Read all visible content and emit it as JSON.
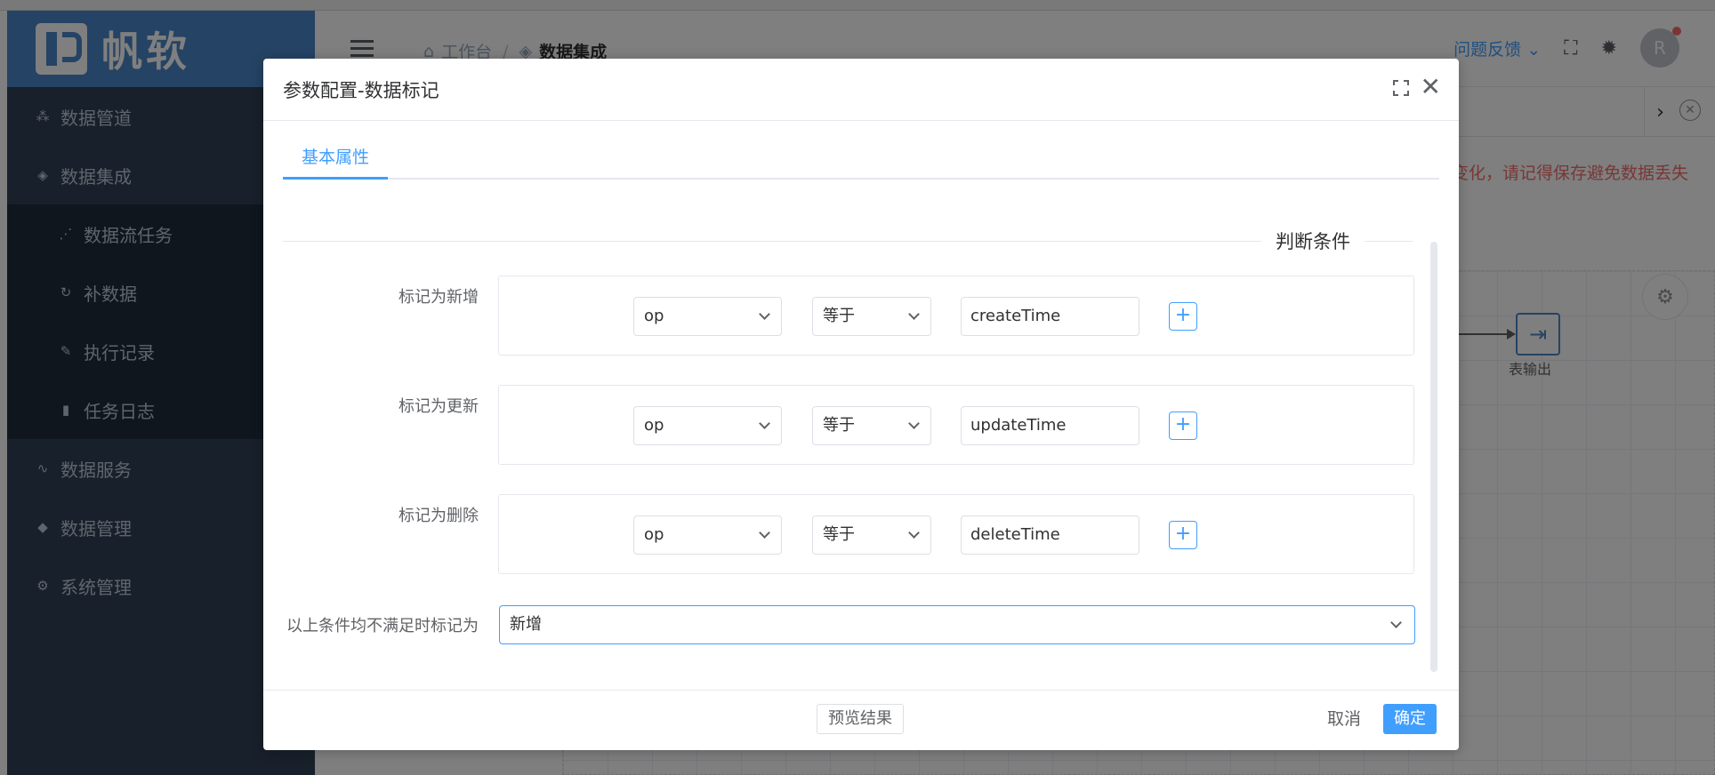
{
  "app": {
    "logo_text": "帆软",
    "sidebar": {
      "items": [
        {
          "label": "数据管道",
          "icon": "pipeline-icon"
        },
        {
          "label": "数据集成",
          "icon": "layers-icon"
        },
        {
          "label": "数据流任务",
          "icon": "share-icon"
        },
        {
          "label": "补数据",
          "icon": "refresh-icon"
        },
        {
          "label": "执行记录",
          "icon": "pen-icon"
        },
        {
          "label": "任务日志",
          "icon": "document-icon"
        },
        {
          "label": "数据服务",
          "icon": "pulse-icon"
        },
        {
          "label": "数据管理",
          "icon": "cube-icon"
        },
        {
          "label": "系统管理",
          "icon": "gear-icon"
        }
      ]
    },
    "breadcrumb": {
      "home": "工作台",
      "separator": "/",
      "current": "数据集成"
    },
    "header": {
      "feedback_label": "问题反馈",
      "avatar_letter": "R"
    },
    "warning_text": "变化，请记得保存避免数据丢失",
    "canvas": {
      "node_label": "表输出"
    }
  },
  "dialog": {
    "title": "参数配置-数据标记",
    "tab_label": "基本属性",
    "section_title": "判断条件",
    "conditions": [
      {
        "label": "标记为新增",
        "field": "op",
        "operator": "等于",
        "value": "createTime"
      },
      {
        "label": "标记为更新",
        "field": "op",
        "operator": "等于",
        "value": "updateTime"
      },
      {
        "label": "标记为删除",
        "field": "op",
        "operator": "等于",
        "value": "deleteTime"
      }
    ],
    "add_label": "+",
    "fallback": {
      "label": "以上条件均不满足时标记为",
      "value": "新增"
    },
    "footer": {
      "preview_label": "预览结果",
      "cancel_label": "取消",
      "ok_label": "确定"
    }
  },
  "colors": {
    "accent": "#409eff",
    "sidebar_bg": "#304156",
    "logo_bg": "#4a86c8",
    "warning": "#f56c6c"
  }
}
